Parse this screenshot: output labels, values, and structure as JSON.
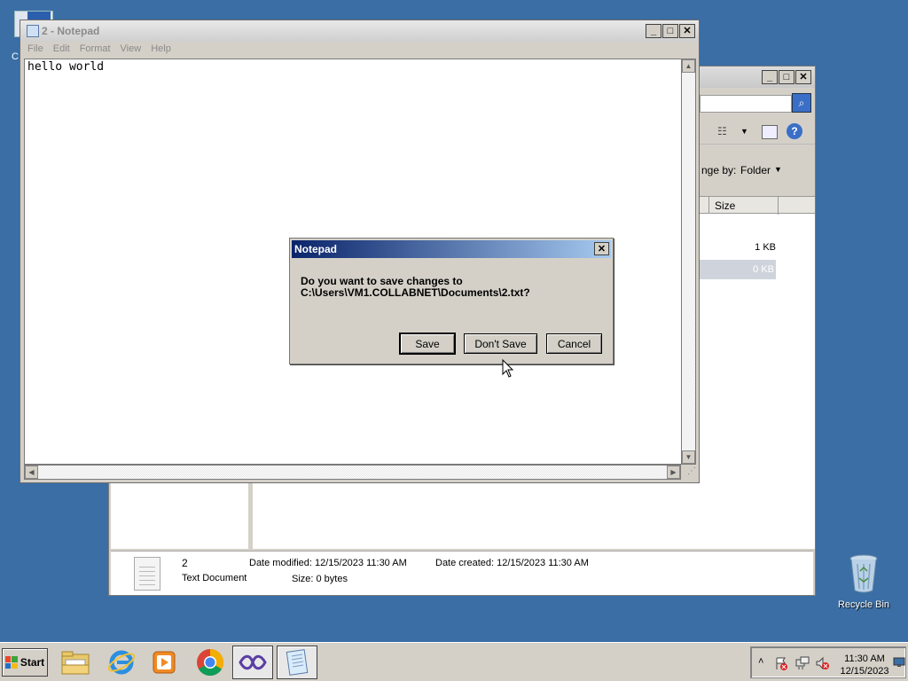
{
  "desktop": {
    "partial_label": "C",
    "recycle_bin_label": "Recycle Bin"
  },
  "explorer": {
    "arrange_label": "nge by:",
    "arrange_value": "Folder",
    "column_size": "Size",
    "rows": [
      {
        "size": "1 KB"
      },
      {
        "size": "0 KB"
      }
    ],
    "details": {
      "name": "2",
      "type": "Text Document",
      "date_modified": "Date modified:  12/15/2023 11:30 AM",
      "size": "Size:  0 bytes",
      "date_created": "Date created:  12/15/2023 11:30 AM"
    }
  },
  "notepad": {
    "title": "2 - Notepad",
    "menu": [
      "File",
      "Edit",
      "Format",
      "View",
      "Help"
    ],
    "content": "hello world"
  },
  "dialog": {
    "title": "Notepad",
    "message_line1": "Do you want to save changes to",
    "message_line2": "C:\\Users\\VM1.COLLABNET\\Documents\\2.txt?",
    "save_label": "Save",
    "dont_save_label": "Don't Save",
    "cancel_label": "Cancel"
  },
  "taskbar": {
    "start_label": "Start",
    "clock_time": "11:30 AM",
    "clock_date": "12/15/2023"
  },
  "icons": [
    "folder-icon",
    "ie-icon",
    "media-player-icon",
    "chrome-icon",
    "visual-studio-icon",
    "notepad-icon"
  ],
  "colors": {
    "desktop": "#3a6ea5",
    "dialog_title_start": "#0a246a",
    "dialog_title_end": "#a6caf0"
  }
}
